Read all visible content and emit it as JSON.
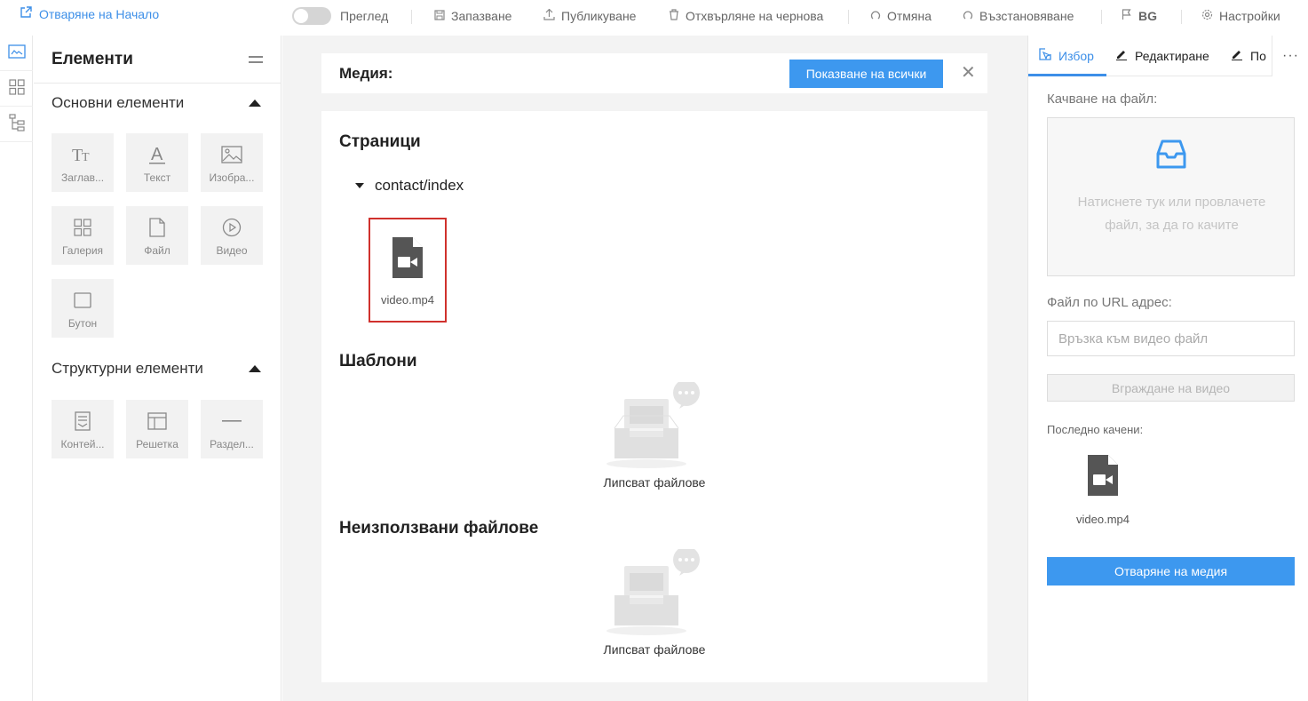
{
  "topbar": {
    "home_label": "Отваряне на Начало",
    "preview_label": "Преглед",
    "save_label": "Запазване",
    "publish_label": "Публикуване",
    "discard_label": "Отхвърляне на чернова",
    "undo_label": "Отмяна",
    "redo_label": "Възстановяване",
    "language_label": "BG",
    "settings_label": "Настройки"
  },
  "elements_panel": {
    "title": "Елементи",
    "basic_section": {
      "title": "Основни елементи",
      "items": [
        {
          "label": "Заглав...",
          "icon": "heading-icon"
        },
        {
          "label": "Текст",
          "icon": "text-icon"
        },
        {
          "label": "Изобра...",
          "icon": "image-icon"
        },
        {
          "label": "Галерия",
          "icon": "gallery-icon"
        },
        {
          "label": "Файл",
          "icon": "file-icon"
        },
        {
          "label": "Видео",
          "icon": "video-icon"
        },
        {
          "label": "Бутон",
          "icon": "button-icon"
        }
      ]
    },
    "structure_section": {
      "title": "Структурни елементи",
      "items": [
        {
          "label": "Контей...",
          "icon": "container-icon"
        },
        {
          "label": "Решетка",
          "icon": "grid-icon"
        },
        {
          "label": "Раздел...",
          "icon": "divider-icon"
        }
      ]
    }
  },
  "media": {
    "label": "Медия:",
    "show_all_label": "Показване на всички",
    "pages_title": "Страници",
    "folder_name": "contact/index",
    "selected_file": "video.mp4",
    "templates_title": "Шаблони",
    "templates_empty": "Липсват файлове",
    "unused_title": "Неизползвани файлове",
    "unused_empty": "Липсват файлове"
  },
  "right_panel": {
    "tabs": [
      "Избор",
      "Редактиране",
      "По"
    ],
    "more_label": "···",
    "upload_label": "Качване на файл:",
    "dropzone_text": "Натиснете тук или провлачете файл, за да го качите",
    "url_label": "Файл по URL адрес:",
    "url_placeholder": "Връзка към видео файл",
    "embed_label": "Вграждане на видео",
    "recent_label": "Последно качени:",
    "recent_file": "video.mp4",
    "open_media_label": "Отваряне на медия"
  },
  "colors": {
    "accent": "#3d98ef",
    "selection_border": "#d0312d"
  }
}
